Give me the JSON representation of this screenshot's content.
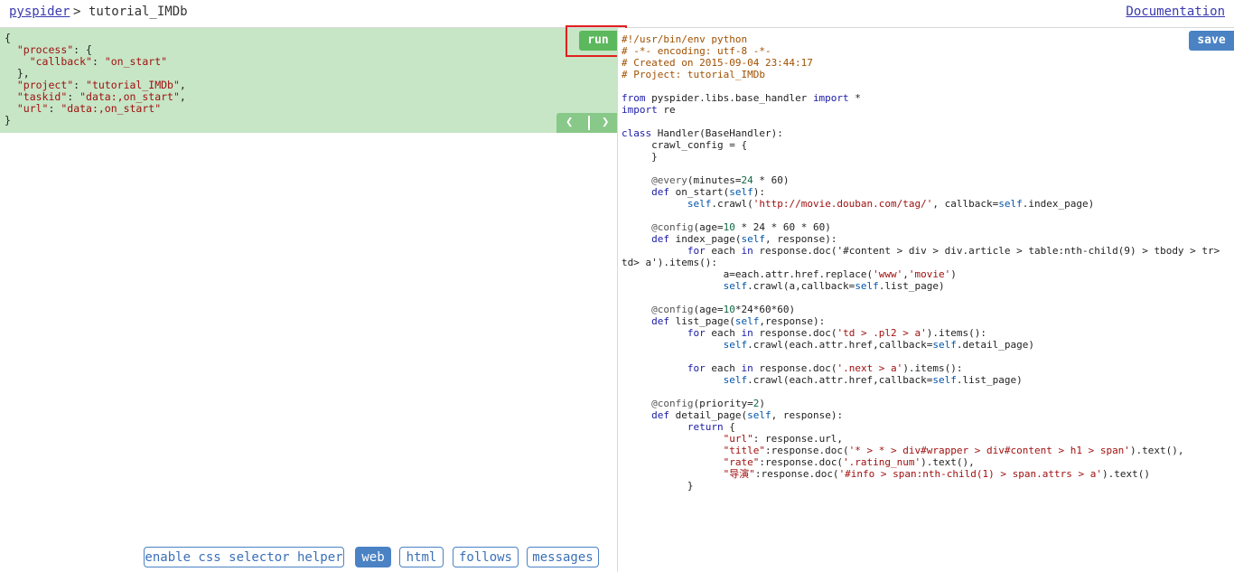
{
  "header": {
    "crumb_root": "pyspider",
    "separator": ">",
    "project": "tutorial_IMDb",
    "doc_link": "Documentation"
  },
  "task": {
    "json_lines": [
      "{",
      "  \"process\": {",
      "    \"callback\": \"on_start\"",
      "  },",
      "  \"project\": \"tutorial_IMDb\",",
      "  \"taskid\": \"data:,on_start\",",
      "  \"url\": \"data:,on_start\"",
      "}"
    ],
    "run_label": "run",
    "prev_icon": "chevron-left-icon",
    "next_icon": "chevron-right-icon"
  },
  "tabs": [
    {
      "label": "enable css selector helper",
      "active": false
    },
    {
      "label": "web",
      "active": true
    },
    {
      "label": "html",
      "active": false
    },
    {
      "label": "follows",
      "active": false
    },
    {
      "label": "messages",
      "active": false
    }
  ],
  "editor": {
    "save_label": "save",
    "lines": [
      "#!/usr/bin/env python",
      "# -*- encoding: utf-8 -*-",
      "# Created on 2015-09-04 23:44:17",
      "# Project: tutorial_IMDb",
      "",
      "from pyspider.libs.base_handler import *",
      "import re",
      "",
      "class Handler(BaseHandler):",
      "     crawl_config = {",
      "     }",
      "",
      "     @every(minutes=24 * 60)",
      "     def on_start(self):",
      "           self.crawl('http://movie.douban.com/tag/', callback=self.index_page)",
      "",
      "     @config(age=10 * 24 * 60 * 60)",
      "     def index_page(self, response):",
      "           for each in response.doc('#content > div > div.article > table:nth-child(9) > tbody > tr>",
      "td> a').items():",
      "                 a=each.attr.href.replace('www','movie')",
      "                 self.crawl(a,callback=self.list_page)",
      "",
      "     @config(age=10*24*60*60)",
      "     def list_page(self,response):",
      "           for each in response.doc('td > .pl2 > a').items():",
      "                 self.crawl(each.attr.href,callback=self.detail_page)",
      "",
      "           for each in response.doc('.next > a').items():",
      "                 self.crawl(each.attr.href,callback=self.list_page)",
      "",
      "     @config(priority=2)",
      "     def detail_page(self, response):",
      "           return {",
      "                 \"url\": response.url,",
      "                 \"title\":response.doc('* > * > div#wrapper > div#content > h1 > span').text(),",
      "                 \"rate\":response.doc('.rating_num').text(),",
      "                 \"导演\":response.doc('#info > span:nth-child(1) > span.attrs > a').text()",
      "           }"
    ]
  }
}
